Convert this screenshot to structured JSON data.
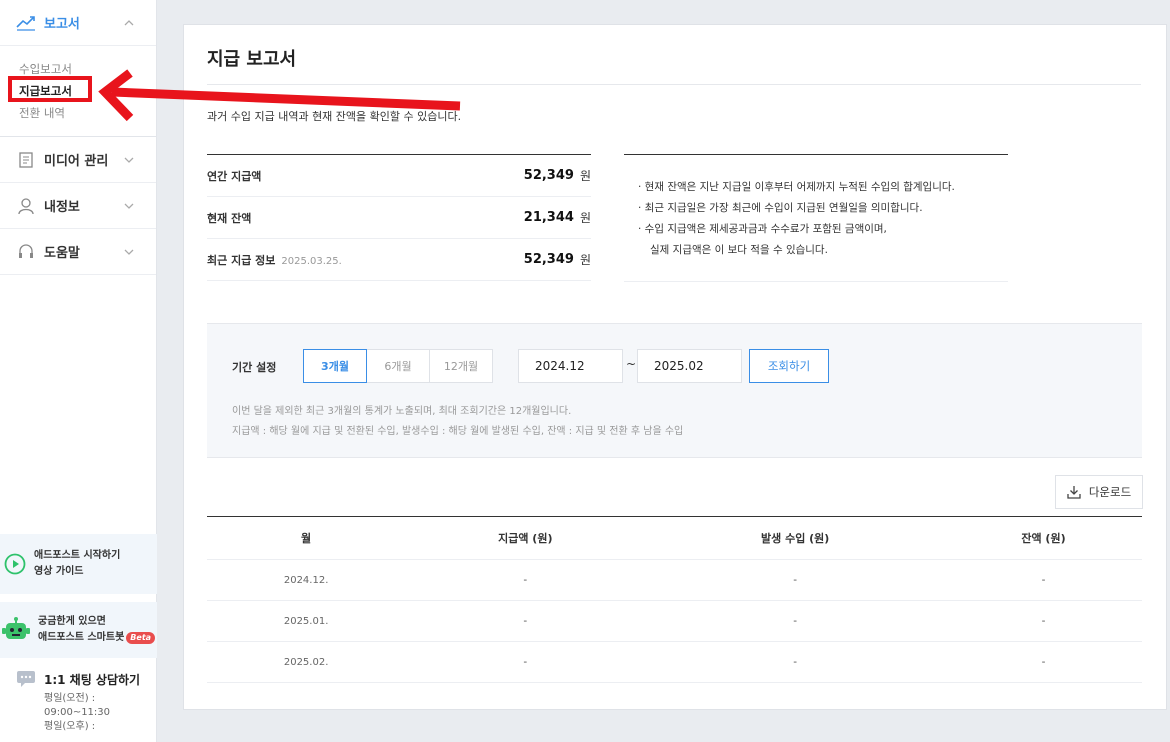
{
  "sidebar": {
    "report": {
      "label": "보고서",
      "icon": "line-chart-icon"
    },
    "sub_items": [
      "수입보고서",
      "지급보고서",
      "전환 내역"
    ],
    "media": {
      "label": "미디어 관리",
      "icon": "document-icon"
    },
    "profile": {
      "label": "내정보",
      "icon": "person-icon"
    },
    "help": {
      "label": "도움말",
      "icon": "headset-icon"
    },
    "promo_guide": {
      "line1": "애드포스트 시작하기",
      "line2": "영상 가이드"
    },
    "promo_bot": {
      "line1": "궁금한게 있으면",
      "line2": "애드포스트 스마트봇",
      "badge": "Beta"
    },
    "chat": {
      "label": "1:1 채팅 상담하기",
      "hours": [
        "평일(오전) :",
        "09:00~11:30",
        "평일(오후) :"
      ]
    }
  },
  "main": {
    "title": "지급 보고서",
    "description": "과거 수입 지급 내역과 현재 잔액을 확인할 수 있습니다.",
    "summary": [
      {
        "label": "연간 지급액",
        "date": "",
        "value": "52,349",
        "unit": "원"
      },
      {
        "label": "현재 잔액",
        "date": "",
        "value": "21,344",
        "unit": "원"
      },
      {
        "label": "최근 지급 정보",
        "date": "2025.03.25.",
        "value": "52,349",
        "unit": "원"
      }
    ],
    "notes": [
      "· 현재 잔액은 지난 지급일 이후부터 어제까지 누적된 수입의 합계입니다.",
      "· 최근 지급일은 가장 최근에 수입이 지급된 연월일을 의미합니다.",
      "· 수입 지급액은 제세공과금과 수수료가 포함된 금액이며,",
      "실제 지급액은 이 보다 적을 수 있습니다."
    ],
    "filter": {
      "label": "기간 설정",
      "periods": [
        "3개월",
        "6개월",
        "12개월"
      ],
      "selected": "3개월",
      "start": "2024.12",
      "separator": "~",
      "end": "2025.02",
      "query_button": "조회하기",
      "note1": "이번 달을 제외한 최근 3개월의 통계가 노출되며, 최대 조회기간은 12개월입니다.",
      "note2": "지급액 : 해당 월에 지급 및 전환된 수입, 발생수입 : 해당 월에 발생된 수입, 잔액 : 지급 및 전환 후 남을 수입"
    },
    "download_button": "다운로드",
    "table": {
      "headers": [
        "월",
        "지급액 (원)",
        "발생 수입 (원)",
        "잔액 (원)"
      ],
      "rows": [
        [
          "2024.12.",
          "-",
          "-",
          "-"
        ],
        [
          "2025.01.",
          "-",
          "-",
          "-"
        ],
        [
          "2025.02.",
          "-",
          "-",
          "-"
        ]
      ]
    }
  },
  "colors": {
    "accent": "#3a8ee6",
    "annotation": "#e8141c",
    "beta": "#e94d4d"
  }
}
